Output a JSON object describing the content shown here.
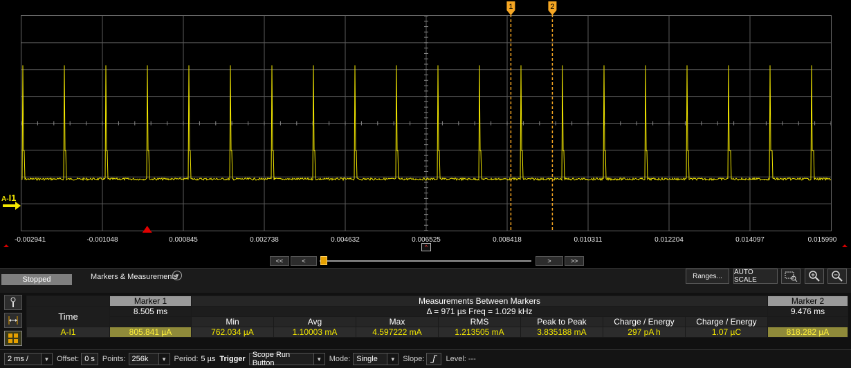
{
  "plot": {
    "x_ticks": [
      "-0.002941",
      "-0.001048",
      "0.000845",
      "0.002738",
      "0.004632",
      "0.006525",
      "0.008418",
      "0.010311",
      "0.012204",
      "0.014097",
      "0.015990"
    ],
    "channel_label_prefix": "A-",
    "channel_label_name": "I1",
    "trace_color": "#f4e800",
    "marker_color": "#f5a623",
    "marker1_label": "1",
    "marker2_label": "2",
    "trigger_color": "#e00000",
    "xrange": [
      -0.002941,
      0.01599
    ],
    "marker1_x": 0.008505,
    "marker2_x": 0.009476,
    "trigger_x": 0.0,
    "pulse_period": 0.000971,
    "pulse_first": -0.002923,
    "pulse_peak_level": 0.77,
    "baseline_level": 0.24
  },
  "nav": {
    "first": "<<",
    "prev": "<",
    "next": ">",
    "last": ">>",
    "center_icon": "^"
  },
  "toolbar": {
    "status": "Stopped",
    "markers_measurements": "Markers & Measurements",
    "ranges": "Ranges...",
    "auto_scale": "AUTO SCALE"
  },
  "icons": {
    "zoom_box": "zoom-box-icon",
    "zoom_in": "zoom-in-icon",
    "zoom_out": "zoom-out-icon"
  },
  "table": {
    "marker1_title": "Marker 1",
    "between_title": "Measurements Between Markers",
    "marker2_title": "Marker 2",
    "time_label": "Time",
    "marker1_time": "8.505 ms",
    "delta_freq": "Δ = 971 µs   Freq = 1.029 kHz",
    "marker2_time": "9.476 ms",
    "columns": [
      "Min",
      "Avg",
      "Max",
      "RMS",
      "Peak to Peak",
      "Charge / Energy",
      "Charge / Energy"
    ],
    "row": {
      "channel": "A-I1",
      "marker1": "805.841 µA",
      "values": [
        "762.034 µA",
        "1.10003 mA",
        "4.597222 mA",
        "1.213505 mA",
        "3.835188 mA",
        "297 pA h",
        "1.07 µC"
      ],
      "marker2": "818.282 µA"
    }
  },
  "bottom": {
    "timebase": "2 ms /",
    "offset_label": "Offset:",
    "offset_value": "0 s",
    "points_label": "Points:",
    "points_value": "256k",
    "period_label": "Period:",
    "period_value": "5 µs",
    "trigger_label": "Trigger",
    "trigger_value": "Scope Run Button",
    "mode_label": "Mode:",
    "mode_value": "Single",
    "slope_label": "Slope:",
    "level_label": "Level:",
    "level_value": "---"
  }
}
